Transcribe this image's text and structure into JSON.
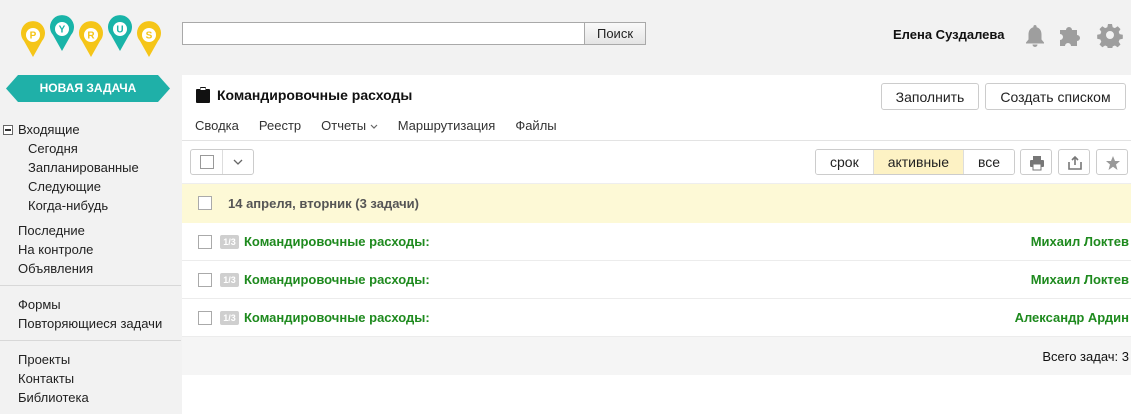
{
  "logo": {
    "letters": [
      "P",
      "Y",
      "R",
      "U",
      "S"
    ],
    "colors": [
      "#f5c518",
      "#19b4a8",
      "#f5c518",
      "#19b4a8",
      "#f5c518"
    ]
  },
  "search": {
    "value": "",
    "button": "Поиск"
  },
  "user": {
    "name": "Елена Суздалева"
  },
  "header_icons": [
    "bell-icon",
    "puzzle-icon",
    "gear-icon"
  ],
  "sidebar": {
    "new_task": "НОВАЯ ЗАДАЧА",
    "new_task_color": "#1fb0a8",
    "inbox": "Входящие",
    "inbox_children": [
      "Сегодня",
      "Запланированные",
      "Следующие",
      "Когда-нибудь"
    ],
    "group2": [
      "Последние",
      "На контроле",
      "Объявления"
    ],
    "group3": [
      "Формы",
      "Повторяющиеся задачи"
    ],
    "group4": [
      "Проекты",
      "Контакты",
      "Библиотека"
    ]
  },
  "main": {
    "form_title": "Командировочные расходы",
    "fill_button": "Заполнить",
    "create_list_button": "Создать списком",
    "tabs": [
      "Сводка",
      "Реестр",
      "Отчеты",
      "Маршрутизация",
      "Файлы"
    ],
    "filters": [
      "срок",
      "активные",
      "все"
    ],
    "active_filter": "активные",
    "group_label": "14 апреля, вторник (3 задачи)",
    "tasks": [
      {
        "step": "1/3",
        "title": "Командировочные расходы:",
        "user": "Михаил Локтев"
      },
      {
        "step": "1/3",
        "title": "Командировочные расходы:",
        "user": "Михаил Локтев"
      },
      {
        "step": "1/3",
        "title": "Командировочные расходы:",
        "user": "Александр Ардин"
      }
    ],
    "total": "Всего задач: 3"
  }
}
